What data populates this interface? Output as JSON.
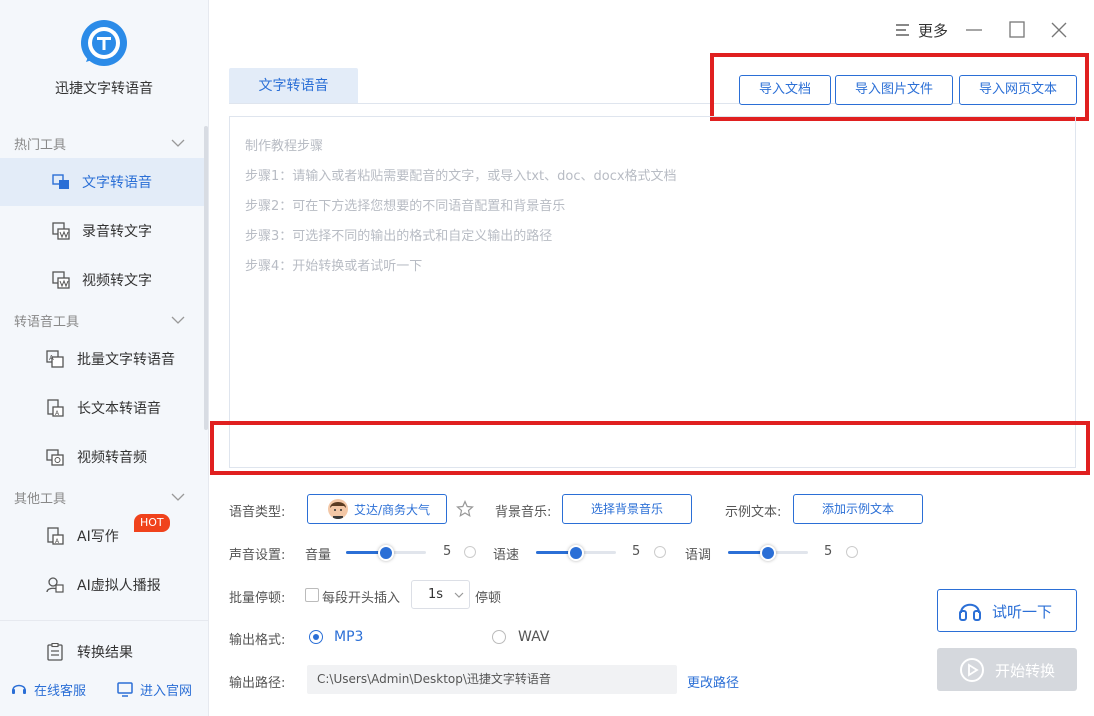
{
  "app": {
    "name": "迅捷文字转语音"
  },
  "window": {
    "more_label": "更多"
  },
  "sidebar": {
    "sections": [
      {
        "title": "热门工具",
        "items": [
          {
            "label": "文字转语音"
          },
          {
            "label": "录音转文字"
          },
          {
            "label": "视频转文字"
          }
        ]
      },
      {
        "title": "转语音工具",
        "items": [
          {
            "label": "批量文字转语音"
          },
          {
            "label": "长文本转语音"
          },
          {
            "label": "视频转音频"
          }
        ]
      },
      {
        "title": "其他工具",
        "items": [
          {
            "label": "AI写作",
            "badge": "HOT"
          },
          {
            "label": "AI虚拟人播报"
          }
        ]
      }
    ],
    "result_label": "转换结果",
    "footer": {
      "service": "在线客服",
      "website": "进入官网"
    }
  },
  "main": {
    "tab_label": "文字转语音",
    "import_buttons": [
      "导入文档",
      "导入图片文件",
      "导入网页文本"
    ],
    "hints": [
      "制作教程步骤",
      "步骤1：请输入或者粘贴需要配音的文字，或导入txt、doc、docx格式文档",
      "步骤2：可在下方选择您想要的不同语音配置和背景音乐",
      "步骤3：可选择不同的输出的格式和自定义输出的路径",
      "步骤4：开始转换或者试听一下"
    ]
  },
  "settings": {
    "voice_type_label": "语音类型:",
    "voice_name": "艾达/商务大气",
    "bg_music_label": "背景音乐:",
    "bg_music_button": "选择背景音乐",
    "sample_label": "示例文本:",
    "sample_button": "添加示例文本",
    "sound_label": "声音设置:",
    "volume": {
      "label": "音量",
      "value": "5",
      "fraction": 0.5
    },
    "speed": {
      "label": "语速",
      "value": "5",
      "fraction": 0.5
    },
    "pitch": {
      "label": "语调",
      "value": "5",
      "fraction": 0.5
    },
    "pause_label": "批量停顿:",
    "pause_checkbox_label": "每段开头插入",
    "pause_value": "1s",
    "pause_suffix": "停顿",
    "format_label": "输出格式:",
    "format_options": [
      "MP3",
      "WAV"
    ],
    "format_selected": "MP3",
    "path_label": "输出路径:",
    "path_value": "C:\\Users\\Admin\\Desktop\\迅捷文字转语音",
    "change_path": "更改路径"
  },
  "actions": {
    "listen": "试听一下",
    "start": "开始转换"
  },
  "colors": {
    "accent": "#2b6fd6",
    "highlight": "#e02020",
    "hot": "#f0421c"
  }
}
